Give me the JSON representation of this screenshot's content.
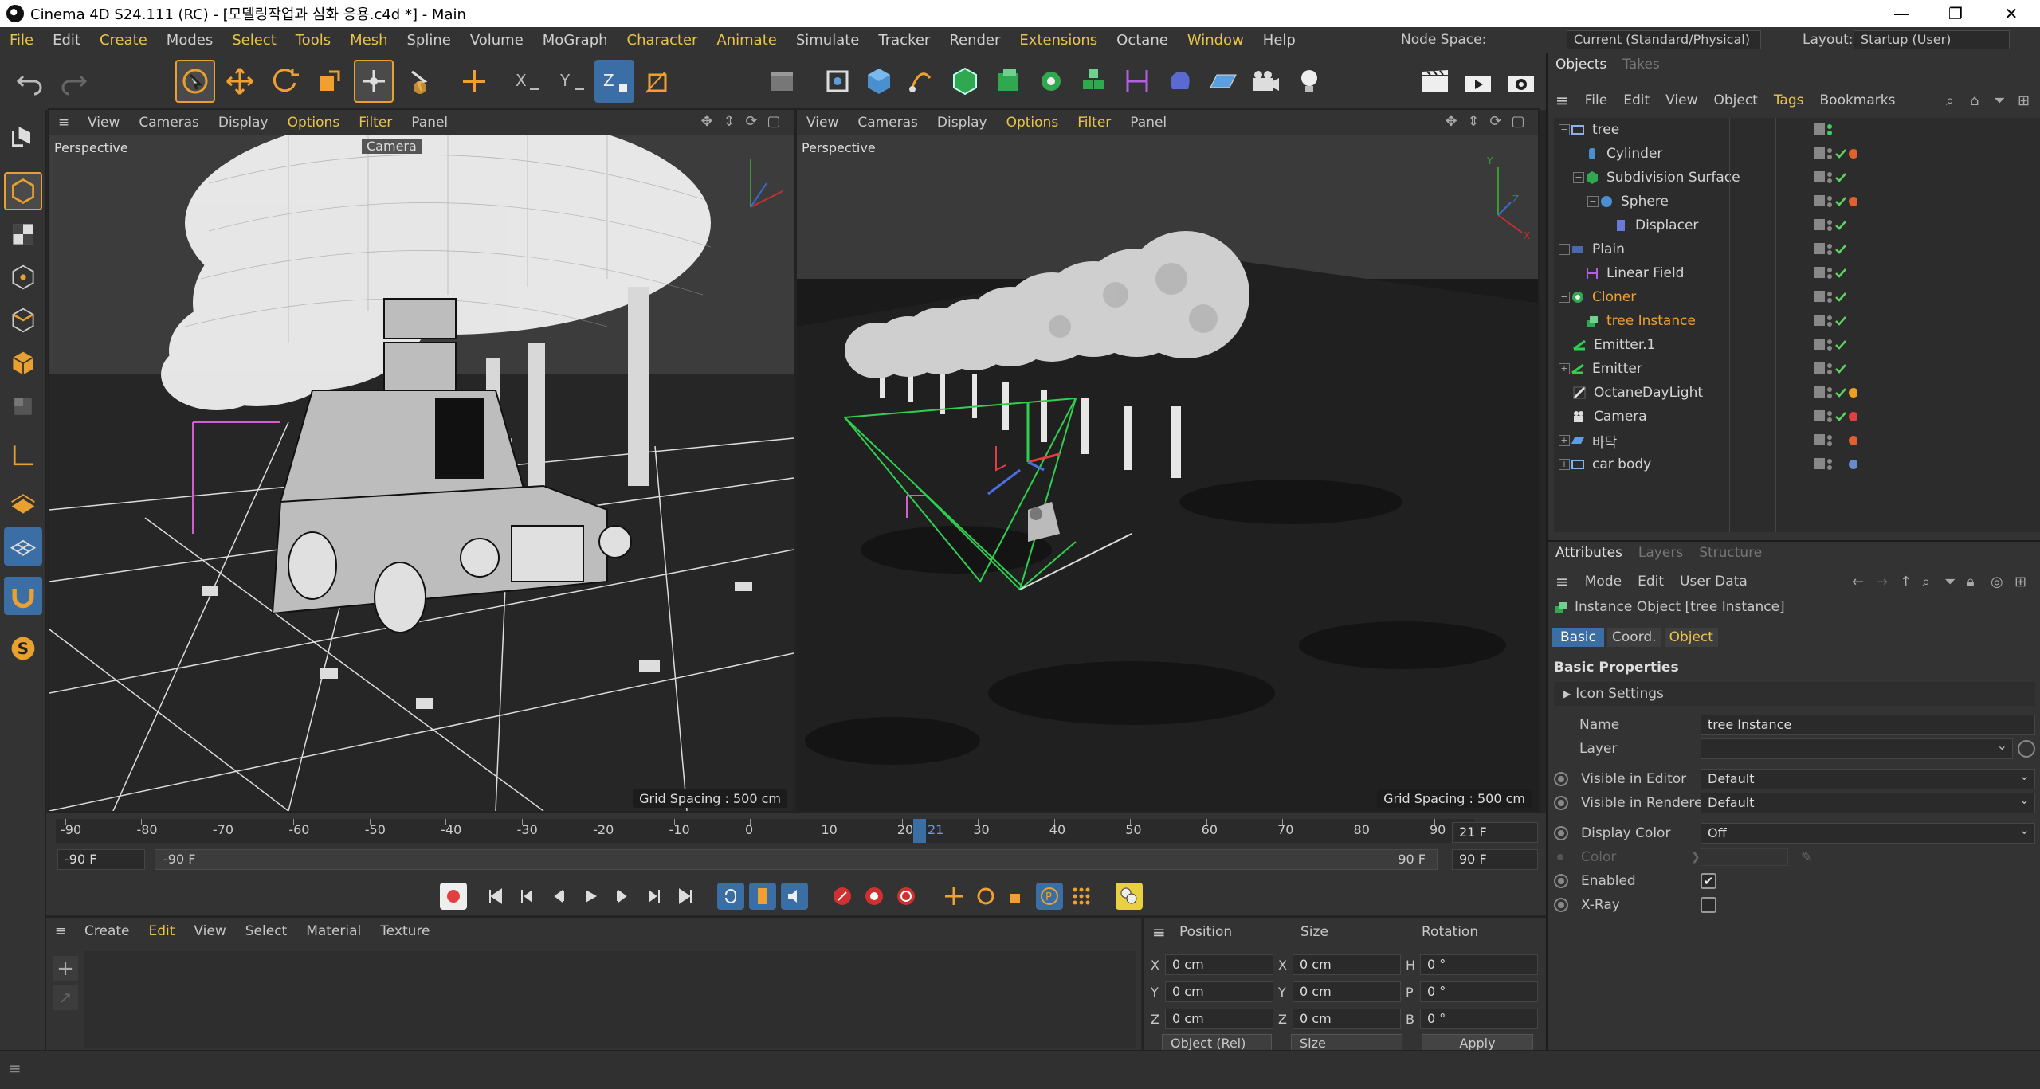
{
  "window": {
    "title": "Cinema 4D S24.111 (RC) - [모델링작업과 심화 응용.c4d *] - Main",
    "minimize": "—",
    "maximize": "❐",
    "close": "✕"
  },
  "menubar": {
    "items": [
      "File",
      "Edit",
      "Create",
      "Modes",
      "Select",
      "Tools",
      "Mesh",
      "Spline",
      "Volume",
      "MoGraph",
      "Character",
      "Animate",
      "Simulate",
      "Tracker",
      "Render",
      "Extensions",
      "Octane",
      "Window",
      "Help"
    ],
    "node_space_label": "Node Space:",
    "node_space_value": "Current (Standard/Physical)",
    "layout_label": "Layout:",
    "layout_value": "Startup (User)"
  },
  "viewport_left": {
    "menu": [
      "View",
      "Cameras",
      "Display",
      "Options",
      "Filter",
      "Panel"
    ],
    "label": "Perspective",
    "camera_label": "Camera",
    "grid": "Grid Spacing : 500 cm"
  },
  "viewport_right": {
    "menu": [
      "View",
      "Cameras",
      "Display",
      "Options",
      "Filter",
      "Panel"
    ],
    "label": "Perspective",
    "grid": "Grid Spacing : 500 cm"
  },
  "objects_panel": {
    "tabs": [
      "Objects",
      "Takes"
    ],
    "menu": [
      "File",
      "Edit",
      "View",
      "Object",
      "Tags",
      "Bookmarks"
    ],
    "rows": [
      {
        "name": "tree",
        "indent": 0,
        "color": "normal",
        "icon": "null-icon"
      },
      {
        "name": "Cylinder",
        "indent": 1,
        "color": "normal",
        "icon": "cylinder-icon"
      },
      {
        "name": "Subdivision Surface",
        "indent": 1,
        "color": "normal",
        "icon": "subdivision-icon"
      },
      {
        "name": "Sphere",
        "indent": 2,
        "color": "normal",
        "icon": "sphere-icon"
      },
      {
        "name": "Displacer",
        "indent": 3,
        "color": "normal",
        "icon": "displacer-icon"
      },
      {
        "name": "Plain",
        "indent": 0,
        "color": "normal",
        "icon": "plain-icon"
      },
      {
        "name": "Linear Field",
        "indent": 1,
        "color": "normal",
        "icon": "linear-field-icon"
      },
      {
        "name": "Cloner",
        "indent": 0,
        "color": "orange",
        "icon": "cloner-icon"
      },
      {
        "name": "tree Instance",
        "indent": 1,
        "color": "orange",
        "icon": "instance-icon"
      },
      {
        "name": "Emitter.1",
        "indent": 0,
        "color": "normal",
        "icon": "emitter-icon"
      },
      {
        "name": "Emitter",
        "indent": 0,
        "color": "normal",
        "icon": "emitter-icon"
      },
      {
        "name": "OctaneDayLight",
        "indent": 0,
        "color": "normal",
        "icon": "daylight-icon"
      },
      {
        "name": "Camera",
        "indent": 0,
        "color": "normal",
        "icon": "camera-icon"
      },
      {
        "name": "바닥",
        "indent": 0,
        "color": "normal",
        "icon": "floor-icon"
      },
      {
        "name": "car body",
        "indent": 0,
        "color": "normal",
        "icon": "null-icon"
      }
    ]
  },
  "attributes_panel": {
    "tabs": [
      "Attributes",
      "Layers",
      "Structure"
    ],
    "menu": [
      "Mode",
      "Edit",
      "User Data"
    ],
    "object_title": "Instance Object [tree Instance]",
    "subtabs": [
      "Basic",
      "Coord.",
      "Object"
    ],
    "section": "Basic Properties",
    "icon_settings": "Icon Settings",
    "name_label": "Name",
    "name_value": "tree Instance",
    "layer_label": "Layer",
    "layer_value": "",
    "visible_editor_label": "Visible in Editor",
    "visible_editor_value": "Default",
    "visible_renderer_label": "Visible in Renderer",
    "visible_renderer_value": "Default",
    "display_color_label": "Display Color",
    "display_color_value": "Off",
    "color_label": "Color",
    "enabled_label": "Enabled",
    "enabled_checked": "✔",
    "xray_label": "X-Ray"
  },
  "timeline": {
    "ticks": [
      "-90",
      "-80",
      "-70",
      "-60",
      "-50",
      "-40",
      "-30",
      "-20",
      "-10",
      "0",
      "10",
      "20",
      "30",
      "40",
      "50",
      "60",
      "70",
      "80",
      "90"
    ],
    "current_marker": "21",
    "current_frame": "21 F",
    "start_field": "-90 F",
    "range_start": "-90 F",
    "range_end": "90 F",
    "end_field": "90 F"
  },
  "material_panel": {
    "menu": [
      "Create",
      "Edit",
      "View",
      "Select",
      "Material",
      "Texture"
    ]
  },
  "coord_panel": {
    "headers": [
      "Position",
      "Size",
      "Rotation"
    ],
    "pos": {
      "x": "0 cm",
      "y": "0 cm",
      "z": "0 cm"
    },
    "size": {
      "x": "0 cm",
      "y": "0 cm",
      "z": "0 cm"
    },
    "rot": {
      "h": "0 °",
      "p": "0 °",
      "b": "0 °"
    },
    "labels": {
      "x": "X",
      "y": "Y",
      "z": "Z",
      "h": "H",
      "p": "P",
      "b": "B"
    },
    "mode": "Object (Rel)",
    "size_mode": "Size",
    "apply": "Apply"
  },
  "colors": {
    "accent": "#e8c448",
    "selected_blue": "#3a6ea5",
    "orange": "#f0a030",
    "green_check": "#5fd35f"
  }
}
